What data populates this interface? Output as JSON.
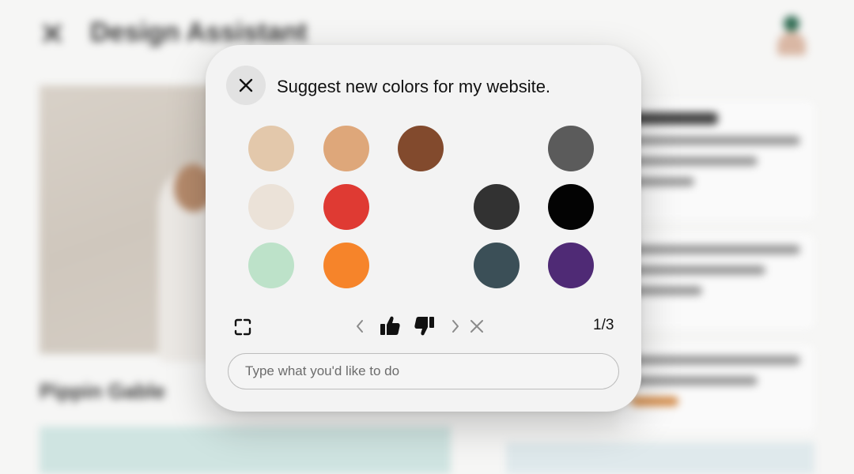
{
  "background_app": {
    "title": "Design Assistant",
    "subtitle": "Pippin Gable"
  },
  "dialog": {
    "prompt": "Suggest new colors for my website.",
    "page_indicator": "1/3",
    "input_placeholder": "Type what you'd like to do",
    "input_value": ""
  },
  "palette": [
    {
      "color": "#e3c8ab"
    },
    {
      "color": "#dea77a"
    },
    {
      "color": "#824a2d"
    },
    {
      "color": "#5b5b5b"
    },
    {
      "color": "#ebe2d8"
    },
    {
      "color": "#df3a33"
    },
    {
      "color": "#323232"
    },
    {
      "color": "#030303"
    },
    {
      "color": "#bde2c9"
    },
    {
      "color": "#f6842a"
    },
    {
      "color": "#3b4f57"
    },
    {
      "color": "#4f2a75"
    }
  ],
  "icons": {
    "close": "close-icon",
    "expand": "expand-icon",
    "prev": "chevron-left-icon",
    "like": "thumbs-up-icon",
    "dislike": "thumbs-down-icon",
    "next": "chevron-right-icon",
    "dismiss": "close-icon"
  }
}
